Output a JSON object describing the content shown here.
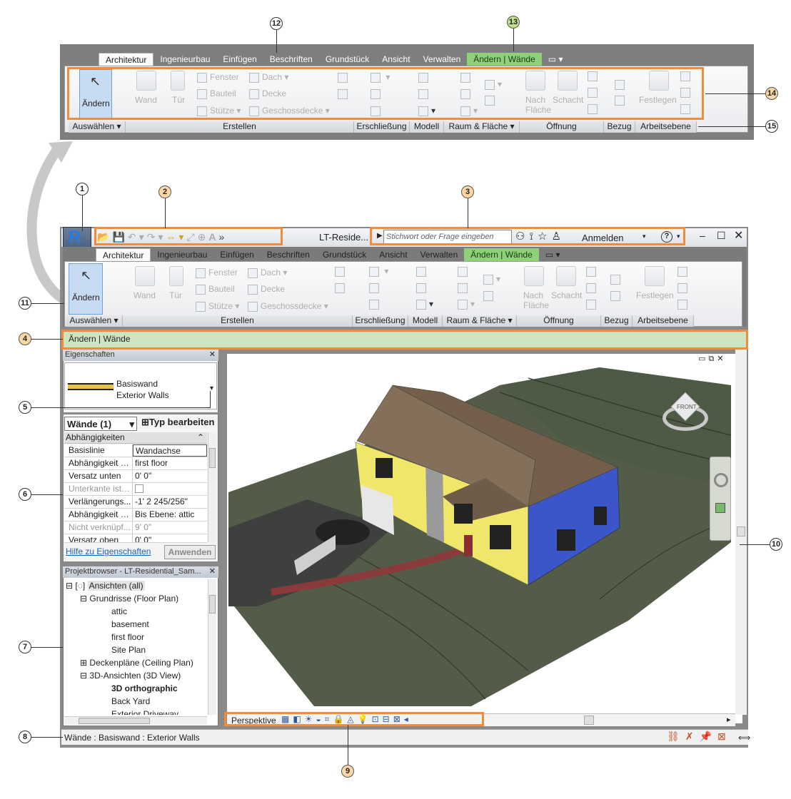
{
  "callouts": [
    "1",
    "2",
    "3",
    "4",
    "5",
    "6",
    "7",
    "8",
    "9",
    "10",
    "11",
    "12",
    "13",
    "14",
    "15"
  ],
  "ribbon": {
    "tabs": [
      "Architektur",
      "Ingenieurbau",
      "Einfügen",
      "Beschriften",
      "Grundstück",
      "Ansicht",
      "Verwalten"
    ],
    "context_tab": "Ändern | Wände",
    "modify_label": "Ändern",
    "wall": "Wand",
    "door": "Tür",
    "window": "Fenster",
    "component": "Bauteil",
    "column": "Stütze",
    "roof": "Dach",
    "ceiling": "Decke",
    "floor": "Geschossdecke",
    "by_face_1": "Nach",
    "by_face_2": "Fläche",
    "shaft": "Schacht",
    "set": "Festlegen",
    "panels": [
      "Auswählen",
      "Erstellen",
      "Erschließung",
      "Modell",
      "Raum & Fläche",
      "Öffnung",
      "Bezug",
      "Arbeitsebene"
    ]
  },
  "titlebar": {
    "title": "LT-Reside...",
    "search_placeholder": "Stichwort oder Frage eingeben",
    "signin": "Anmelden",
    "app_badge": "LT",
    "app_letter": "R"
  },
  "context_bar": "Ändern | Wände",
  "properties": {
    "header": "Eigenschaften",
    "type_name_1": "Basiswand",
    "type_name_2": "Exterior Walls",
    "selector": "Wände (1)",
    "edit_type": "Typ bearbeiten",
    "group": "Abhängigkeiten",
    "rows": [
      {
        "k": "Basislinie",
        "v": "Wandachse"
      },
      {
        "k": "Abhängigkeit u...",
        "v": "first floor"
      },
      {
        "k": "Versatz unten",
        "v": "0'  0\""
      },
      {
        "k": "Unterkante ist f...",
        "v": ""
      },
      {
        "k": "Verlängerungs...",
        "v": "-1'  2 245/256\""
      },
      {
        "k": "Abhängigkeit o...",
        "v": "Bis Ebene: attic"
      },
      {
        "k": "Nicht verknüpf...",
        "v": "9'  0\""
      },
      {
        "k": "Versatz oben",
        "v": "0'  0\""
      }
    ],
    "help_link": "Hilfe zu Eigenschaften",
    "apply": "Anwenden"
  },
  "browser": {
    "header": "Projektbrowser - LT-Residential_Sam...",
    "items": [
      {
        "label": "Ansichten (all)",
        "level": 0
      },
      {
        "label": "Grundrisse (Floor Plan)",
        "level": 1
      },
      {
        "label": "attic",
        "level": 2
      },
      {
        "label": "basement",
        "level": 2
      },
      {
        "label": "first floor",
        "level": 2
      },
      {
        "label": "Site Plan",
        "level": 2
      },
      {
        "label": "Deckenpläne (Ceiling Plan)",
        "level": 1
      },
      {
        "label": "3D-Ansichten (3D View)",
        "level": 1
      },
      {
        "label": "3D orthographic",
        "level": 2
      },
      {
        "label": "Back Yard",
        "level": 2
      },
      {
        "label": "Exterior Driveway",
        "level": 2
      }
    ]
  },
  "view": {
    "mode": "Perspektive",
    "cube_face": "FRONT"
  },
  "status": {
    "text": "Wände : Basiswand : Exterior Walls"
  }
}
